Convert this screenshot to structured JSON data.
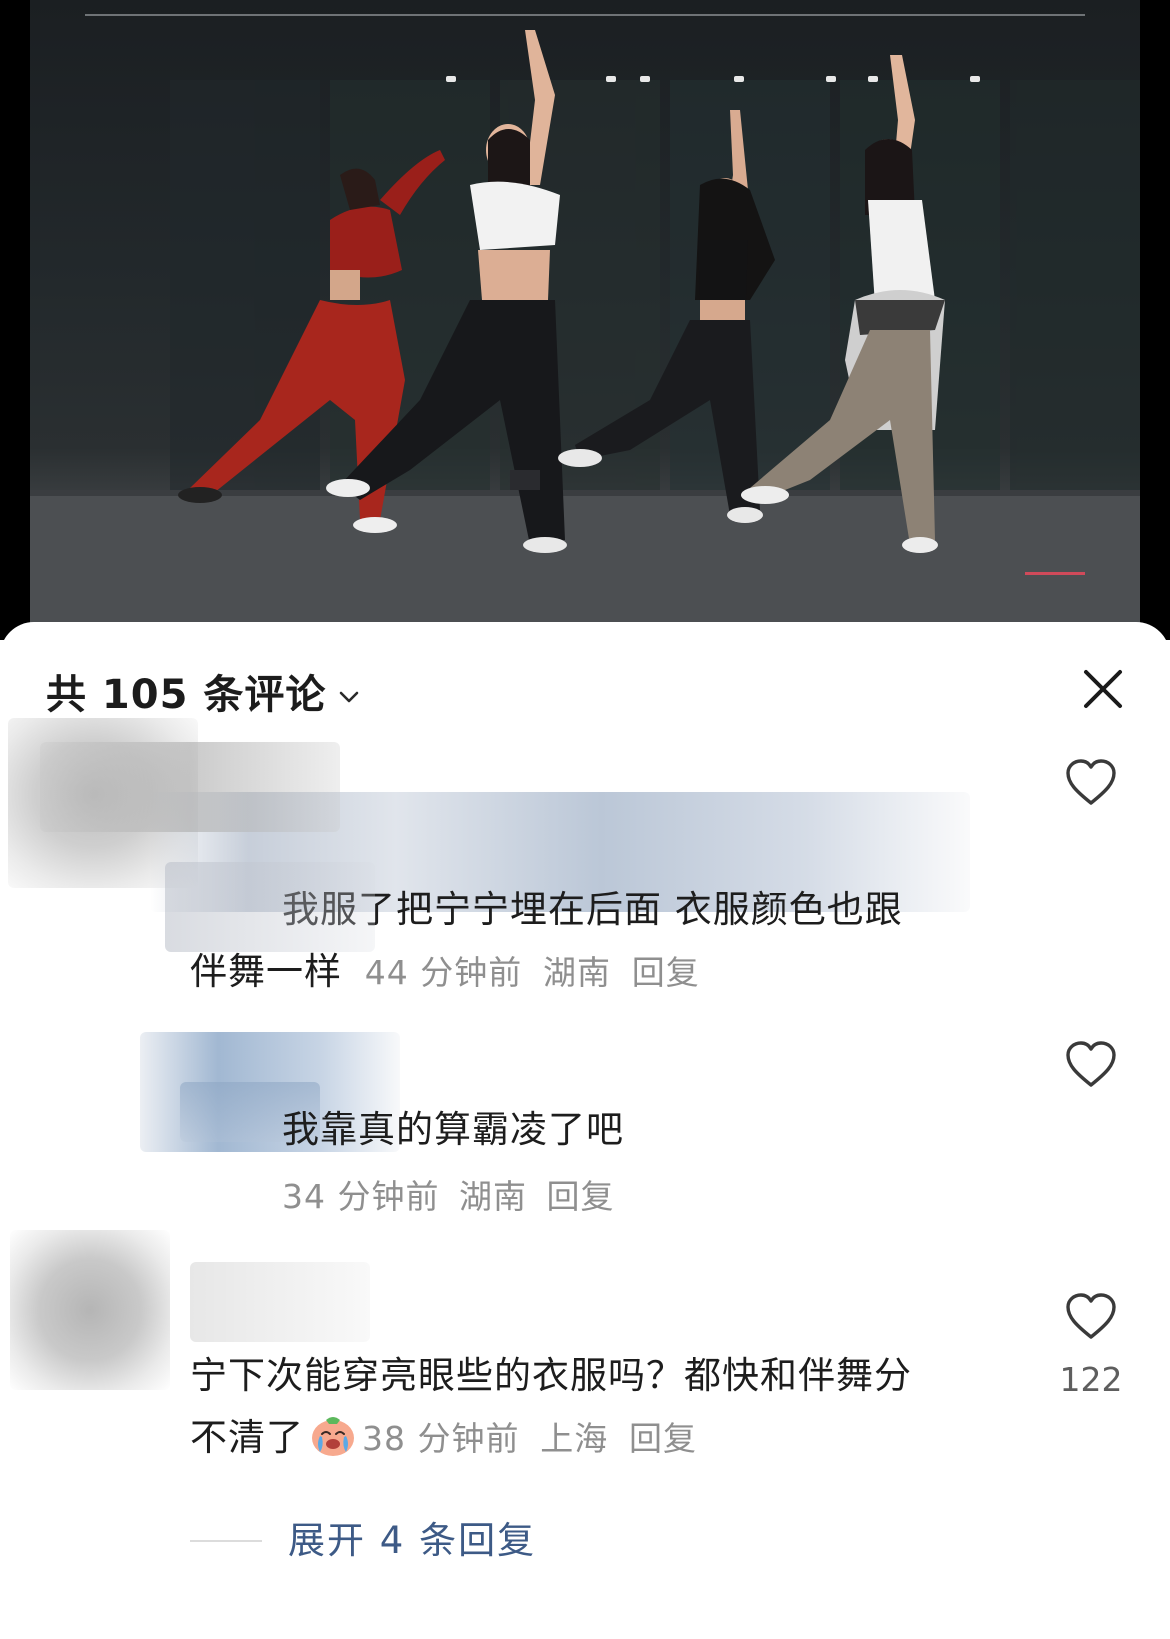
{
  "comments_header": {
    "title": "共 105 条评论",
    "chevron_icon": "chevron-down-icon",
    "close_icon": "close-icon"
  },
  "comments": [
    {
      "text_line1": "我服了把宁宁埋在后面 衣服颜色也跟",
      "text_line2": "伴舞一样",
      "time": "44 分钟前",
      "location": "湖南",
      "reply_label": "回复",
      "like_icon": "heart-outline-icon"
    },
    {
      "text_line1": "我靠真的算霸凌了吧",
      "time": "34 分钟前",
      "location": "湖南",
      "reply_label": "回复",
      "like_icon": "heart-outline-icon"
    },
    {
      "text_line1": "宁下次能穿亮眼些的衣服吗？都快和伴舞分",
      "text_line2": "不清了",
      "emoji": "crying-face-emoji",
      "time": "38 分钟前",
      "location": "上海",
      "reply_label": "回复",
      "like_icon": "heart-outline-icon",
      "like_count": "122"
    }
  ],
  "expand_replies": {
    "label": "展开 4 条回复"
  },
  "colors": {
    "text": "#1d1d1d",
    "meta": "#8f8f8f",
    "link": "#3d5a86"
  }
}
